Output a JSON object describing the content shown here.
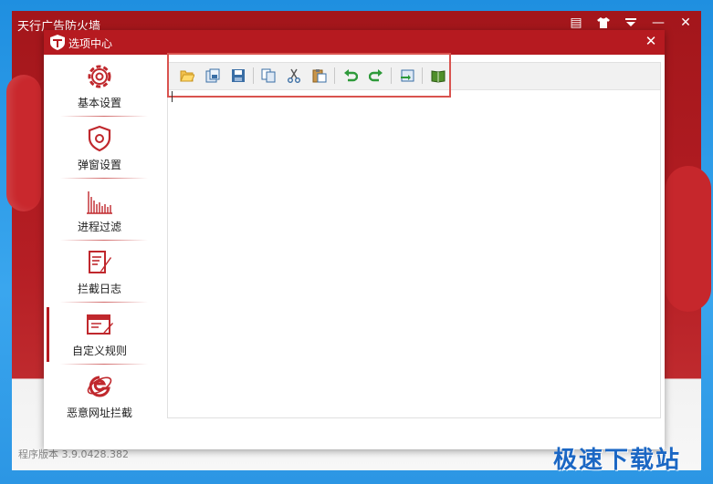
{
  "app": {
    "title": "天行广告防火墙"
  },
  "window_controls": [
    {
      "name": "message-icon",
      "glyph": "▤"
    },
    {
      "name": "skin-shirt-icon",
      "glyph": "👕"
    },
    {
      "name": "menu-dropdown-icon",
      "glyph": "▼"
    },
    {
      "name": "minimize-icon",
      "glyph": "—"
    },
    {
      "name": "close-icon",
      "glyph": "✕"
    }
  ],
  "dialog": {
    "title": "选项中心",
    "close_glyph": "✕"
  },
  "sidebar": {
    "items": [
      {
        "label": "基本设置",
        "icon": "gear-icon"
      },
      {
        "label": "弹窗设置",
        "icon": "shield-icon"
      },
      {
        "label": "进程过滤",
        "icon": "bar-chart-icon"
      },
      {
        "label": "拦截日志",
        "icon": "log-pen-icon"
      },
      {
        "label": "自定义规则",
        "icon": "rule-window-icon",
        "active": true
      },
      {
        "label": "恶意网址拦截",
        "icon": "ie-browser-icon"
      }
    ]
  },
  "toolbar": {
    "buttons": [
      "open-file-icon",
      "save-as-icon",
      "save-icon",
      "copy-icon",
      "cut-icon",
      "paste-icon",
      "undo-icon",
      "redo-icon",
      "import-icon",
      "help-book-icon"
    ]
  },
  "editor": {
    "content": ""
  },
  "status": {
    "version": "程序版本 3.9.0428.382"
  },
  "watermark": {
    "text": "极速下载站"
  },
  "colors": {
    "brand_red": "#b61a20",
    "desktop_blue": "#2c96e4",
    "highlight_red": "#d9534f",
    "watermark_blue": "#1b67c4"
  }
}
